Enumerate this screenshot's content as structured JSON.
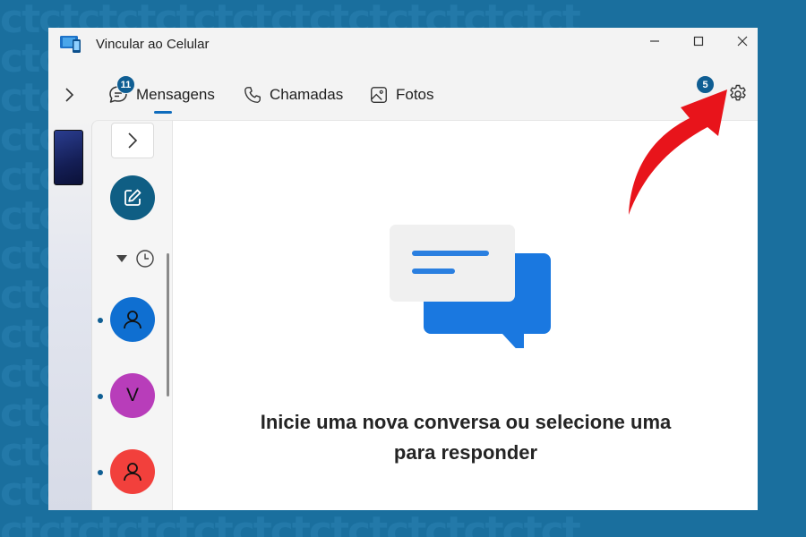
{
  "window": {
    "title": "Vincular ao Celular"
  },
  "navbar": {
    "tabs": [
      {
        "label": "Mensagens",
        "icon": "chat-icon",
        "badge": "11",
        "selected": true
      },
      {
        "label": "Chamadas",
        "icon": "phone-icon"
      },
      {
        "label": "Fotos",
        "icon": "photos-icon"
      }
    ],
    "notifications_badge": "5",
    "settings_icon": "gear-icon"
  },
  "conversations": {
    "items": [
      {
        "avatar": "person-icon",
        "color": "#0f6fd1",
        "unread": true
      },
      {
        "avatar": "V",
        "color": "#b83dba",
        "unread": true
      },
      {
        "avatar": "person-icon",
        "color": "#f2403c",
        "unread": true
      }
    ]
  },
  "main": {
    "empty_message_line1": "Inicie uma nova conversa ou selecione uma",
    "empty_message_line2": "para responder"
  },
  "colors": {
    "accent": "#0f6cbd",
    "background_frame": "#1a6f9e",
    "annotation_arrow": "#e8141b"
  }
}
